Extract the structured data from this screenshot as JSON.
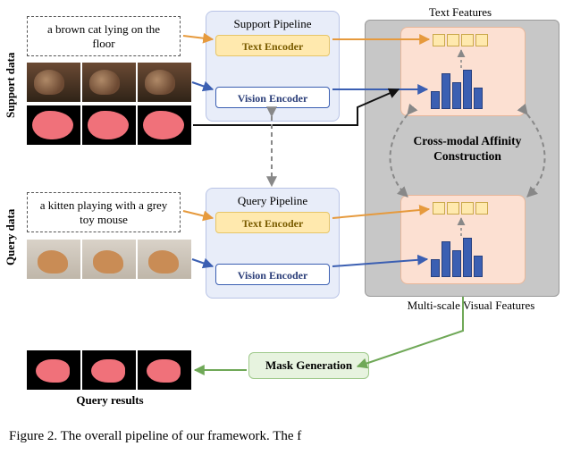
{
  "labels": {
    "support_data": "Support data",
    "query_data": "Query data",
    "query_results": "Query results"
  },
  "support": {
    "text_prompt": "a brown cat lying on the floor"
  },
  "query": {
    "text_prompt": "a kitten playing with a grey toy mouse"
  },
  "pipelines": {
    "support": {
      "title": "Support Pipeline",
      "text_encoder": "Text Encoder",
      "vision_encoder": "Vision Encoder"
    },
    "query": {
      "title": "Query Pipeline",
      "text_encoder": "Text Encoder",
      "vision_encoder": "Vision Encoder"
    }
  },
  "right": {
    "text_features_title": "Text Features",
    "cross_modal_label": "Cross-modal Affinity Construction",
    "multiscale_label": "Multi-scale Visual Features"
  },
  "mask_generation": "Mask Generation",
  "figure_caption": "Figure 2.  The overall pipeline of our framework.  The f"
}
